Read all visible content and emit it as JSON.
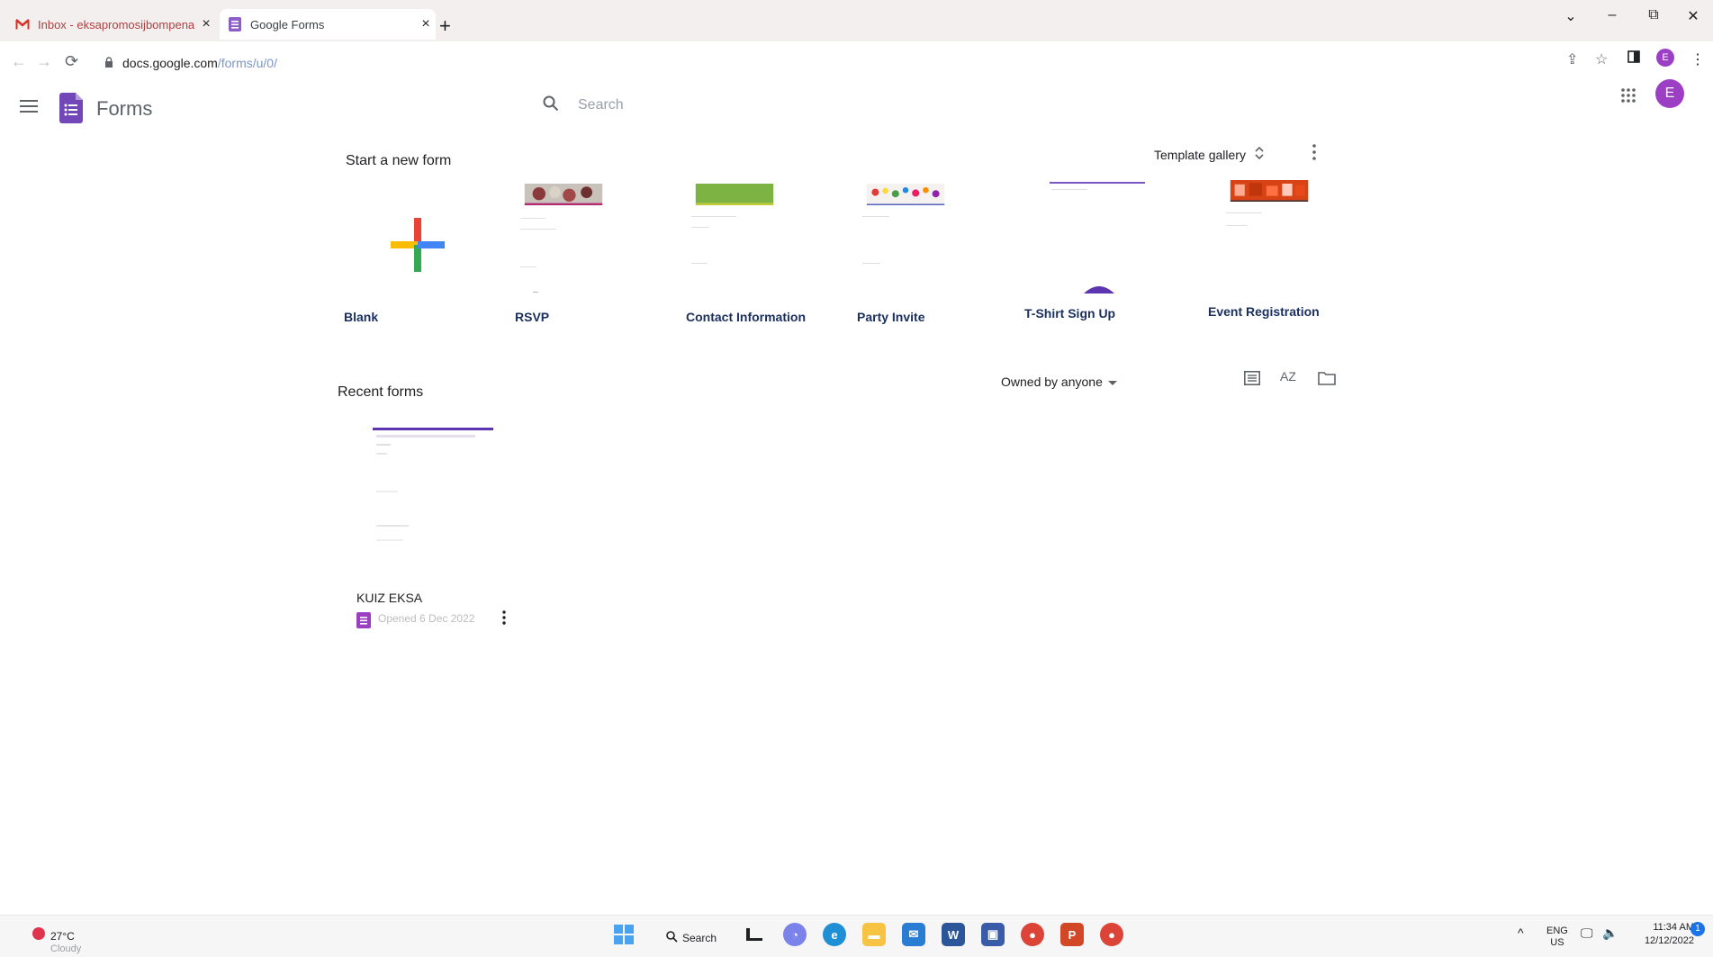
{
  "browser": {
    "tabs": [
      {
        "title": "Inbox - eksapromosijbompena",
        "close": "×"
      },
      {
        "title": "Google Forms",
        "close": "×"
      }
    ],
    "new_tab": "+",
    "url_host": "docs.google.com",
    "url_path": "/forms/u/0/",
    "profile_initial": "E",
    "window_controls": {
      "dropdown": "⌄",
      "minimize": "–",
      "restore": "⧉",
      "close": "✕"
    }
  },
  "app": {
    "title": "Forms",
    "search_placeholder": "Search",
    "avatar_initial": "E"
  },
  "start_section": {
    "title": "Start a new form",
    "template_gallery_label": "Template gallery",
    "templates": [
      {
        "label": "Blank"
      },
      {
        "label": "RSVP"
      },
      {
        "label": "Contact Information"
      },
      {
        "label": "Party Invite"
      },
      {
        "label": "T-Shirt Sign Up"
      },
      {
        "label": "Event Registration"
      }
    ]
  },
  "recent_section": {
    "title": "Recent forms",
    "owner_filter": "Owned by anyone",
    "sort_label": "AZ",
    "documents": [
      {
        "name": "KUIZ EKSA",
        "meta": "Opened 6 Dec 2022"
      }
    ]
  },
  "taskbar": {
    "weather_temp": "27°C",
    "weather_condition": "Cloudy",
    "search_label": "Search",
    "lang_top": "ENG",
    "lang_bottom": "US",
    "time": "11:34 AM",
    "date": "12/12/2022",
    "notification_count": "1"
  },
  "colors": {
    "forms_purple": "#673ab7",
    "avatar_purple": "#9c3fc4",
    "label_navy": "#1a2f5e"
  }
}
